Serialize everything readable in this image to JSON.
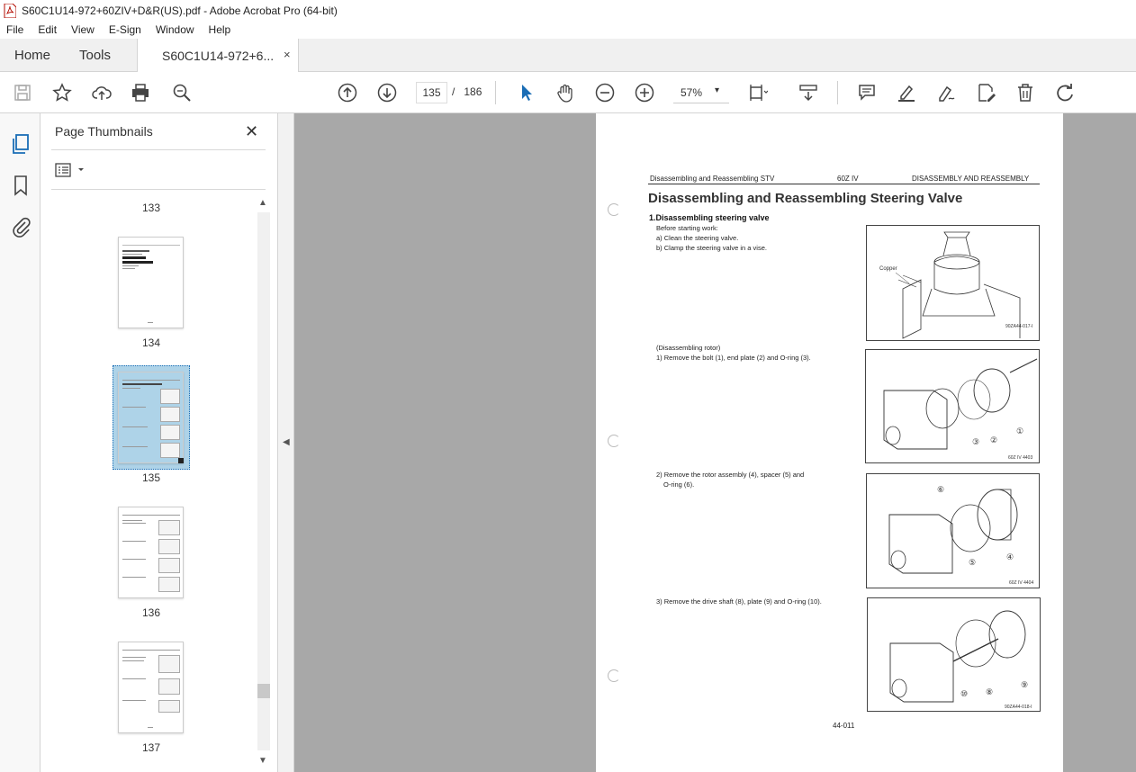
{
  "window": {
    "title": "S60C1U14-972+60ZIV+D&R(US).pdf - Adobe Acrobat Pro (64-bit)"
  },
  "menu": [
    "File",
    "Edit",
    "View",
    "E-Sign",
    "Window",
    "Help"
  ],
  "tabs": {
    "home": "Home",
    "tools": "Tools",
    "document": "S60C1U14-972+6...",
    "close": "×"
  },
  "toolbar": {
    "current_page": "135",
    "page_separator": "/",
    "total_pages": "186",
    "zoom": "57%",
    "zoom_dropdown": "▾"
  },
  "panel": {
    "title": "Page Thumbnails",
    "close": "✕",
    "thumbnails": [
      {
        "label": "133"
      },
      {
        "label": "134"
      },
      {
        "label": "135",
        "selected": true
      },
      {
        "label": "136"
      },
      {
        "label": "137"
      }
    ]
  },
  "document_page": {
    "header_left": "Disassembling and Reassembling STV",
    "header_center": "60Z IV",
    "header_right": "DISASSEMBLY AND REASSEMBLY",
    "title": "Disassembling and Reassembling Steering Valve",
    "section": "1.Disassembling steering valve",
    "before_start": "Before starting work:",
    "step_a": "a) Clean the steering valve.",
    "step_b": "b) Clamp the steering valve in a vise.",
    "rotor_heading": "(Disassembling rotor)",
    "step1": "1) Remove the bolt (1), end plate (2) and O-ring (3).",
    "step2_line1": "2) Remove  the  rotor  assembly  (4),  spacer  (5)  and",
    "step2_line2": "O-ring (6).",
    "step3": "3) Remove the drive shaft (8), plate (9) and O-ring (10).",
    "fig1_label": "Copper",
    "fig1_code": "90ZA44-017-I",
    "fig2_code": "60Z IV 4403",
    "fig3_code": "60Z IV 4404",
    "fig4_code": "90ZA44-018-I",
    "callouts_fig2": [
      "③",
      "②",
      "①"
    ],
    "callouts_fig3": [
      "⑥",
      "⑤",
      "④"
    ],
    "callouts_fig4": [
      "⑩",
      "⑧",
      "⑨"
    ],
    "page_number": "44-011"
  },
  "colors": {
    "accent": "#1a6db5",
    "viewer_bg": "#a8a8a8",
    "thumb_selected": "#aed3e8"
  }
}
